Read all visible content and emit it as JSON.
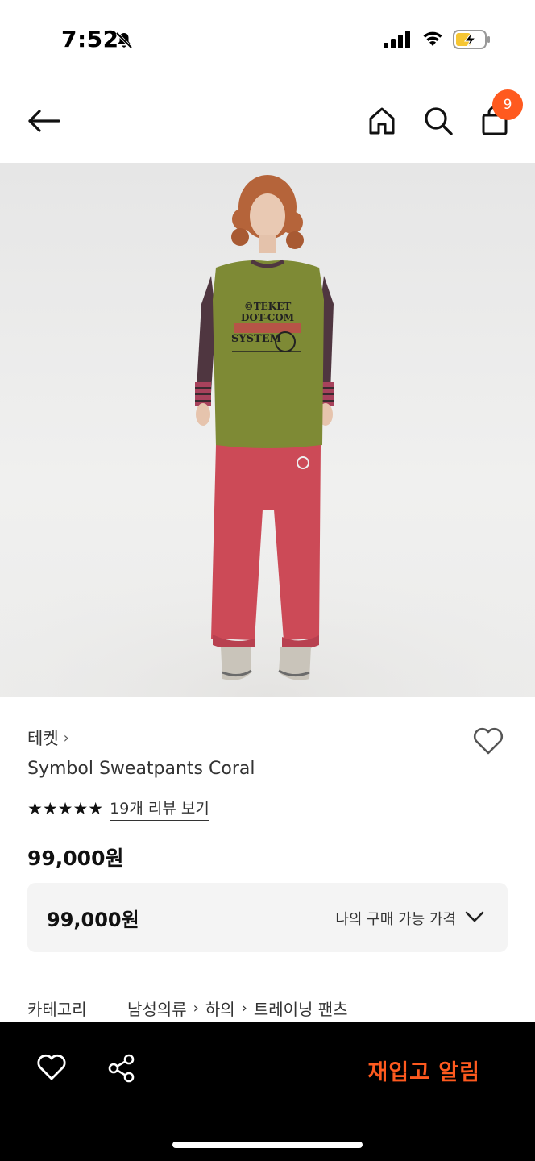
{
  "status": {
    "time": "7:52"
  },
  "nav": {
    "cart_count": "9"
  },
  "product": {
    "brand": "테켓",
    "brand_chevron": "›",
    "name": "Symbol Sweatpants Coral",
    "stars": "★★★★★",
    "review_link": "19개 리뷰 보기",
    "price": "99,000원",
    "price_box": {
      "price": "99,000원",
      "label": "나의 구매 가능 가격"
    },
    "category": {
      "label": "카테고리",
      "path": [
        "남성의류",
        "하의",
        "트레이닝 팬츠"
      ],
      "separator": "›"
    },
    "shirt_print": [
      "©TEKET",
      "DOT-COM",
      "SYSTEM"
    ]
  },
  "bottom_bar": {
    "restock_label": "재입고 알림"
  },
  "colors": {
    "accent": "#ff5a1f",
    "bottom_bar": "#000000",
    "price_box_bg": "#f4f4f4"
  },
  "icons": [
    "bell-slash-icon",
    "signal-icon",
    "wifi-icon",
    "battery-charging-icon",
    "back-arrow-icon",
    "home-icon",
    "search-icon",
    "shopping-bag-icon",
    "heart-outline-icon",
    "share-icon",
    "chevron-down-icon"
  ]
}
